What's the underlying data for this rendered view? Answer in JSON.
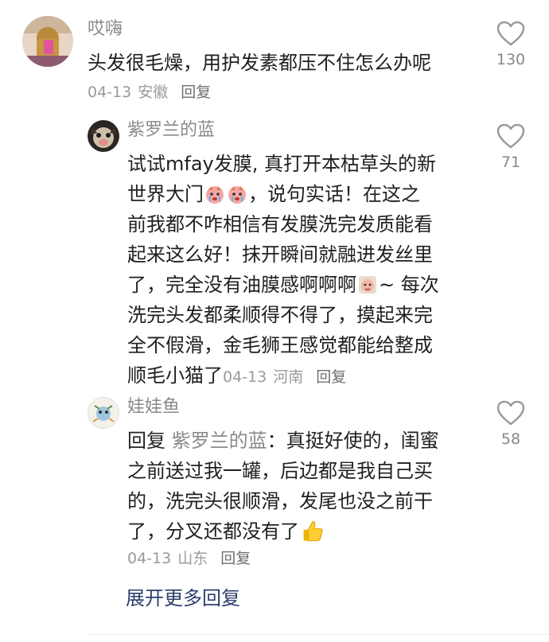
{
  "comments": [
    {
      "author": "哎嗨",
      "text": "头发很毛燥，用护发素都压不住怎么办呢",
      "date": "04-13",
      "location": "安徽",
      "reply_label": "回复",
      "likes": "130"
    },
    {
      "author": "紫罗兰的蓝",
      "text_lines": [
        "试试mfay发膜, 真打开本枯草头的新",
        "世界大门",
        "，说句实话！在这之",
        "前我都不咋相信有发膜洗完发质能看",
        "起来这么好！抹开瞬间就融进发丝里",
        "了，完全没有油膜感啊啊啊",
        "~ 每次",
        "洗完头发都柔顺得不得了，摸起来完",
        "全不假滑，金毛狮王感觉都能给整成",
        "顺毛小猫了"
      ],
      "date": "04-13",
      "location": "河南",
      "reply_label": "回复",
      "likes": "71"
    },
    {
      "author": "娃娃鱼",
      "reply_prefix": "回复",
      "reply_target": "紫罗兰的蓝",
      "text_lines": [
        "：真挺好使的，闺蜜",
        "之前送过我一罐，后边都是我自己买",
        "的，洗完头很顺滑，发尾也没之前干",
        "了，分叉还都没有了"
      ],
      "date": "04-13",
      "location": "山东",
      "reply_label": "回复",
      "likes": "58"
    }
  ],
  "expand_more": "展开更多回复",
  "colors": {
    "link": "#2b3f6b",
    "muted": "#8a8a8a"
  }
}
